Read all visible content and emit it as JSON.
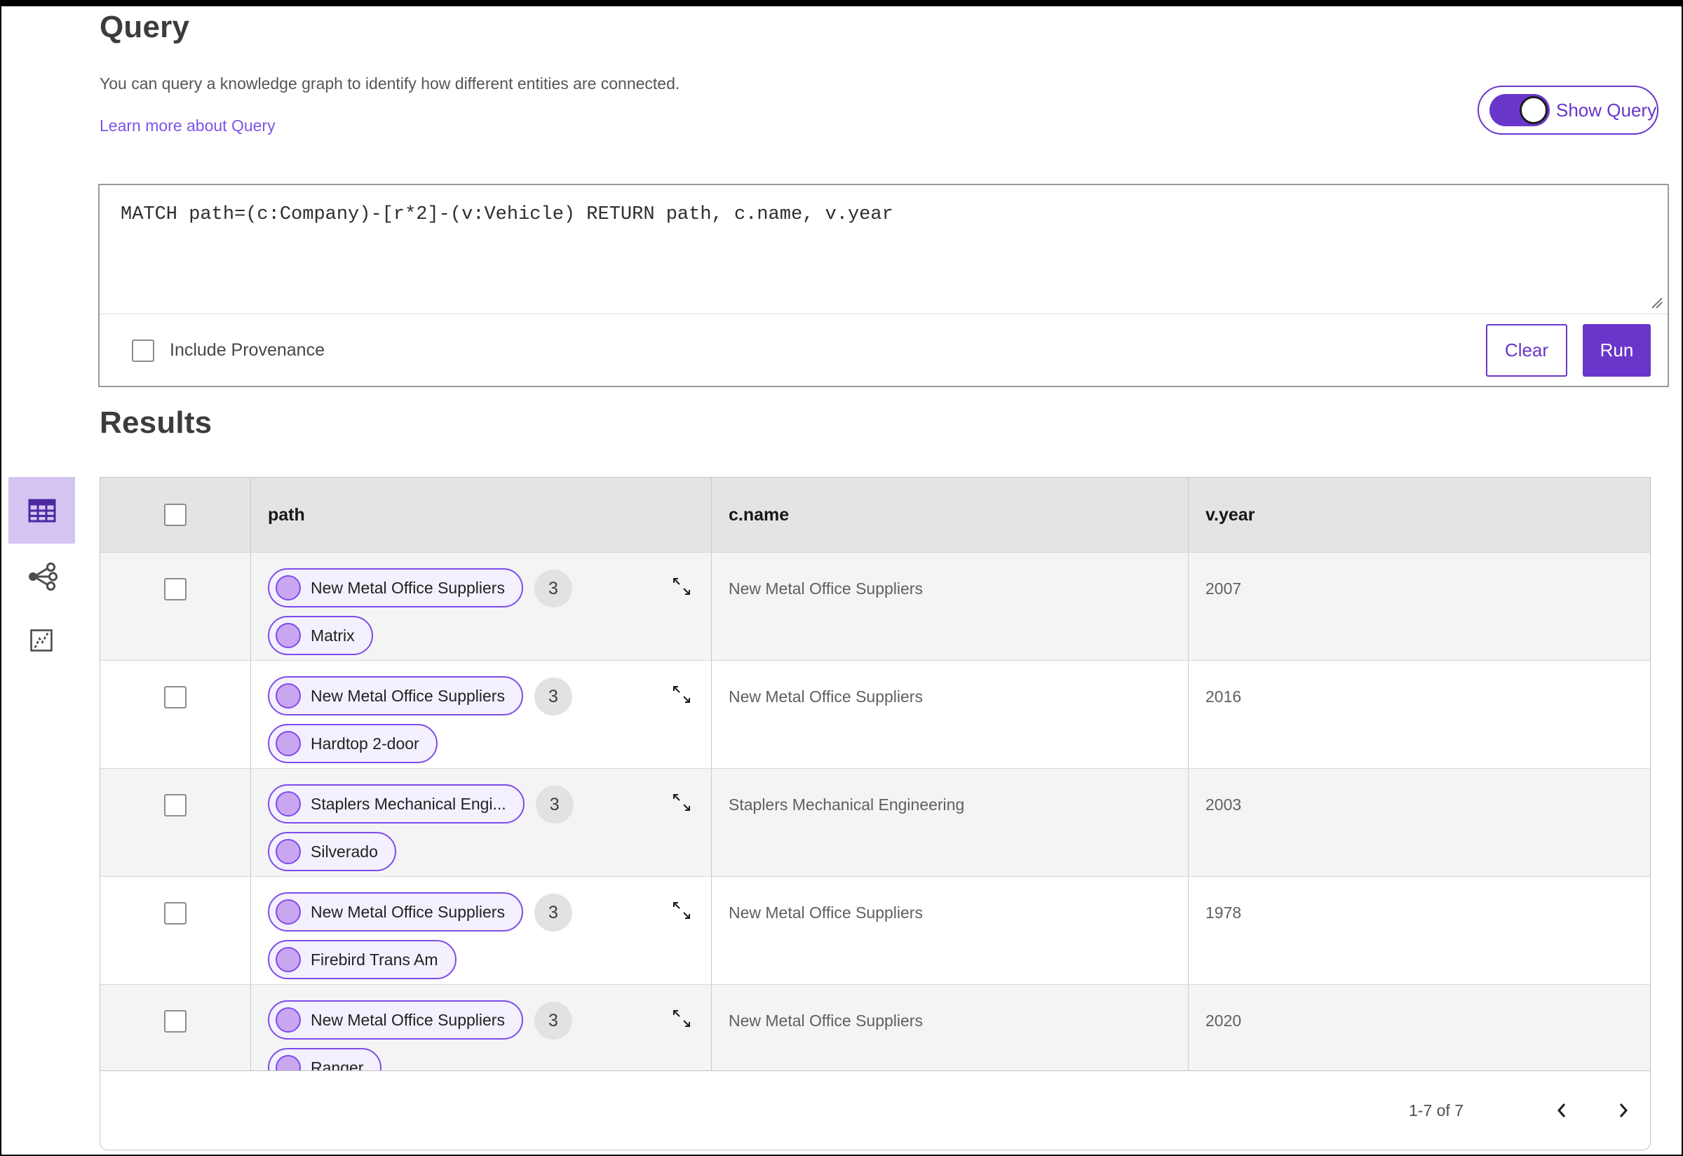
{
  "query_section": {
    "title": "Query",
    "description": "You can query a knowledge graph to identify how different entities are connected.",
    "learn_more_link": "Learn more about Query",
    "show_query_toggle": {
      "label": "Show Query",
      "state": "on"
    },
    "query_text": "MATCH path=(c:Company)-[r*2]-(v:Vehicle) RETURN path, c.name, v.year",
    "include_provenance": {
      "label": "Include Provenance",
      "checked": false
    },
    "clear_button": "Clear",
    "run_button": "Run"
  },
  "results_section": {
    "title": "Results",
    "view_rail": {
      "selected": "table",
      "icons": [
        "table-view-icon",
        "graph-view-icon",
        "chart-view-icon"
      ]
    },
    "table": {
      "columns": [
        "path",
        "c.name",
        "v.year"
      ],
      "rows": [
        {
          "path_nodes": [
            "New Metal Office Suppliers",
            "Matrix"
          ],
          "count": "3",
          "c_name": "New Metal Office Suppliers",
          "v_year": "2007"
        },
        {
          "path_nodes": [
            "New Metal Office Suppliers",
            "Hardtop 2-door"
          ],
          "count": "3",
          "c_name": "New Metal Office Suppliers",
          "v_year": "2016"
        },
        {
          "path_nodes": [
            "Staplers Mechanical Engi...",
            "Silverado"
          ],
          "count": "3",
          "c_name": "Staplers Mechanical Engineering",
          "v_year": "2003"
        },
        {
          "path_nodes": [
            "New Metal Office Suppliers",
            "Firebird Trans Am"
          ],
          "count": "3",
          "c_name": "New Metal Office Suppliers",
          "v_year": "1978"
        },
        {
          "path_nodes": [
            "New Metal Office Suppliers",
            "Ranger"
          ],
          "count": "3",
          "c_name": "New Metal Office Suppliers",
          "v_year": "2020"
        }
      ]
    },
    "pagination": {
      "range_label": "1-7 of 7",
      "icons": [
        "chevron-left-icon",
        "chevron-right-icon"
      ]
    }
  },
  "colors": {
    "accent_purple": "#6936cb",
    "link_purple": "#7d55e6",
    "pill_border": "#7c4deb",
    "pill_background": "#f4f0fd",
    "node_fill": "#c8a7f0",
    "selected_view_background": "#d4c4f2",
    "table_header_background": "#e4e4e4",
    "zebra_row_background": "#f4f4f4"
  }
}
